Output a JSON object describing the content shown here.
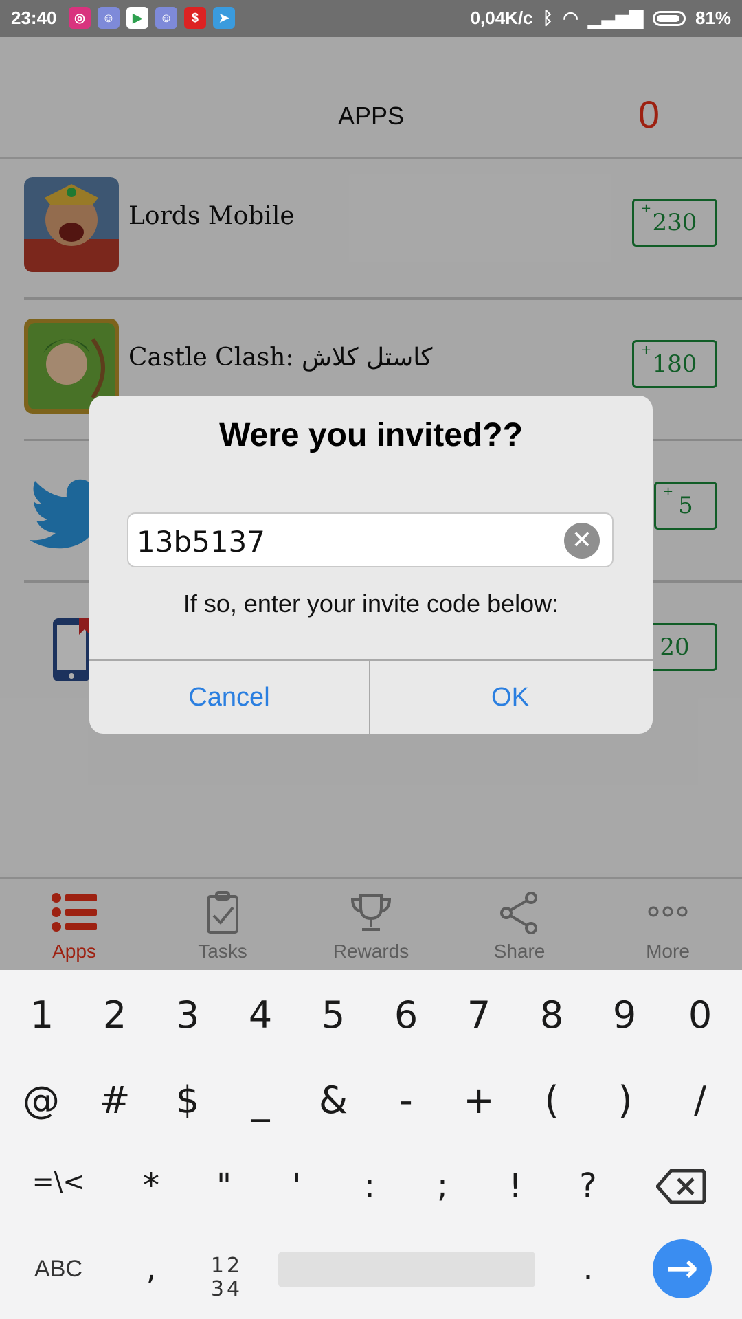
{
  "status_bar": {
    "time": "23:40",
    "network_speed": "0,04K/c",
    "battery": "81%",
    "notification_icons": [
      "instagram-icon",
      "discord-icon",
      "play-store-icon",
      "discord-icon",
      "money-app-icon",
      "telegram-icon"
    ]
  },
  "header": {
    "title": "APPS",
    "points_total": "0"
  },
  "apps": [
    {
      "name": "Lords Mobile",
      "points_prefix": "+",
      "points": "230"
    },
    {
      "name": "Castle Clash: كاستل كلاش",
      "points_prefix": "+",
      "points": "180"
    },
    {
      "name": "",
      "points_prefix": "+",
      "points": "5"
    },
    {
      "name": "",
      "points_prefix": "+",
      "points": "20"
    }
  ],
  "dialog": {
    "title": "Were you invited??",
    "input_value": "13b5137",
    "message": "If so, enter your invite code below:",
    "cancel_label": "Cancel",
    "ok_label": "OK"
  },
  "tabs": [
    {
      "label": "Apps",
      "icon": "list-icon",
      "active": true
    },
    {
      "label": "Tasks",
      "icon": "clipboard-check-icon",
      "active": false
    },
    {
      "label": "Rewards",
      "icon": "trophy-icon",
      "active": false
    },
    {
      "label": "Share",
      "icon": "share-icon",
      "active": false
    },
    {
      "label": "More",
      "icon": "more-icon",
      "active": false
    }
  ],
  "keyboard": {
    "row1": [
      "1",
      "2",
      "3",
      "4",
      "5",
      "6",
      "7",
      "8",
      "9",
      "0"
    ],
    "row2": [
      "@",
      "#",
      "$",
      "_",
      "&",
      "-",
      "+",
      "(",
      ")",
      "/"
    ],
    "row3": [
      "=\\<",
      "*",
      "\"",
      "'",
      ":",
      ";",
      "!",
      "?"
    ],
    "abc_label": "ABC",
    "comma": ",",
    "numsym_label": "12 34",
    "period": "."
  },
  "colors": {
    "accent_red": "#e8321a",
    "points_green": "#1a8a3a",
    "dialog_blue": "#2b7fe0",
    "enter_blue": "#3a8df1"
  }
}
